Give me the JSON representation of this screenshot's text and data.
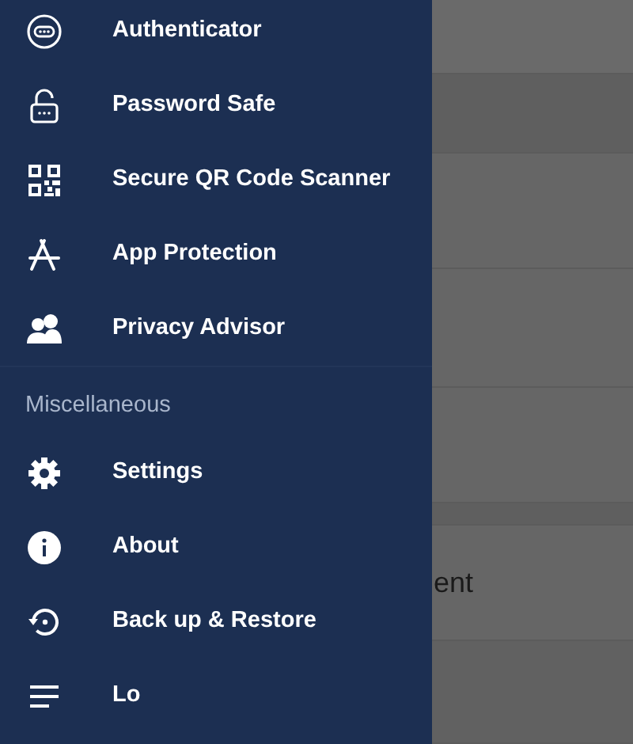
{
  "drawer": {
    "items": [
      {
        "label": "Authenticator"
      },
      {
        "label": "Password Safe"
      },
      {
        "label": "Secure QR Code Scanner"
      },
      {
        "label": "App Protection"
      },
      {
        "label": "Privacy Advisor"
      }
    ],
    "sections": [
      {
        "title": "Miscellaneous",
        "items": [
          {
            "label": "Settings"
          },
          {
            "label": "About"
          },
          {
            "label": "Back up & Restore"
          },
          {
            "label": "Lo"
          }
        ]
      }
    ]
  },
  "background": {
    "texts": [
      "ent"
    ]
  }
}
